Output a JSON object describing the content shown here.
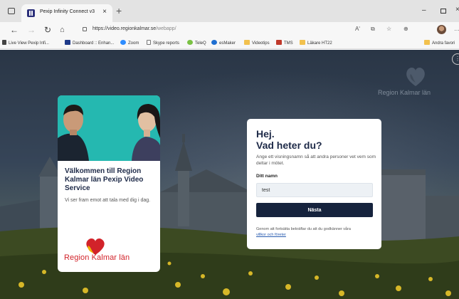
{
  "browser": {
    "tab_title": "Pexip Infinity Connect v3",
    "tab_close": "×",
    "new_tab": "+",
    "url_host": "https://video.regionkalmar.se",
    "url_path": "/webapp/",
    "reader_label": "Aʹ",
    "window": {
      "minimize": "–",
      "close": "×"
    },
    "bookmarks": [
      {
        "label": "Live View Pexip Infi...",
        "icon": "pexip-icon"
      },
      {
        "label": "Dashboard :: Enhan...",
        "icon": "dashboard-icon"
      },
      {
        "label": "Zoom",
        "icon": "zoom-icon"
      },
      {
        "label": "Skype reports",
        "icon": "page-icon"
      },
      {
        "label": "TeleQ",
        "icon": "teleq-icon"
      },
      {
        "label": "esMaker",
        "icon": "esmaker-icon"
      },
      {
        "label": "Videotips",
        "icon": "folder-icon"
      },
      {
        "label": "TMS",
        "icon": "tms-icon"
      },
      {
        "label": "Läkare HT22",
        "icon": "folder-icon"
      }
    ],
    "other_favorites": "Andra favori"
  },
  "page": {
    "brand_top": "Region Kalmar län",
    "welcome": {
      "title": "Välkommen till Region Kalmar län Pexip Video Service",
      "subtitle": "Vi ser fram emot att tala med dig i dag.",
      "logo_text": "Region Kalmar län"
    },
    "form": {
      "greeting": "Hej.",
      "question": "Vad heter du?",
      "description": "Ange ett visningsnamn så att andra personer vet vem som deltar i mötet.",
      "name_label": "Ditt namn",
      "name_value": "test",
      "next_button": "Nästa",
      "terms_text": "Genom att fortsätta bekräftar du att du godkänner våra",
      "terms_link": "villkor och företer"
    },
    "colors": {
      "brand_red": "#d2232a",
      "brand_navy": "#16233d",
      "photo_teal": "#25b8b0"
    }
  }
}
